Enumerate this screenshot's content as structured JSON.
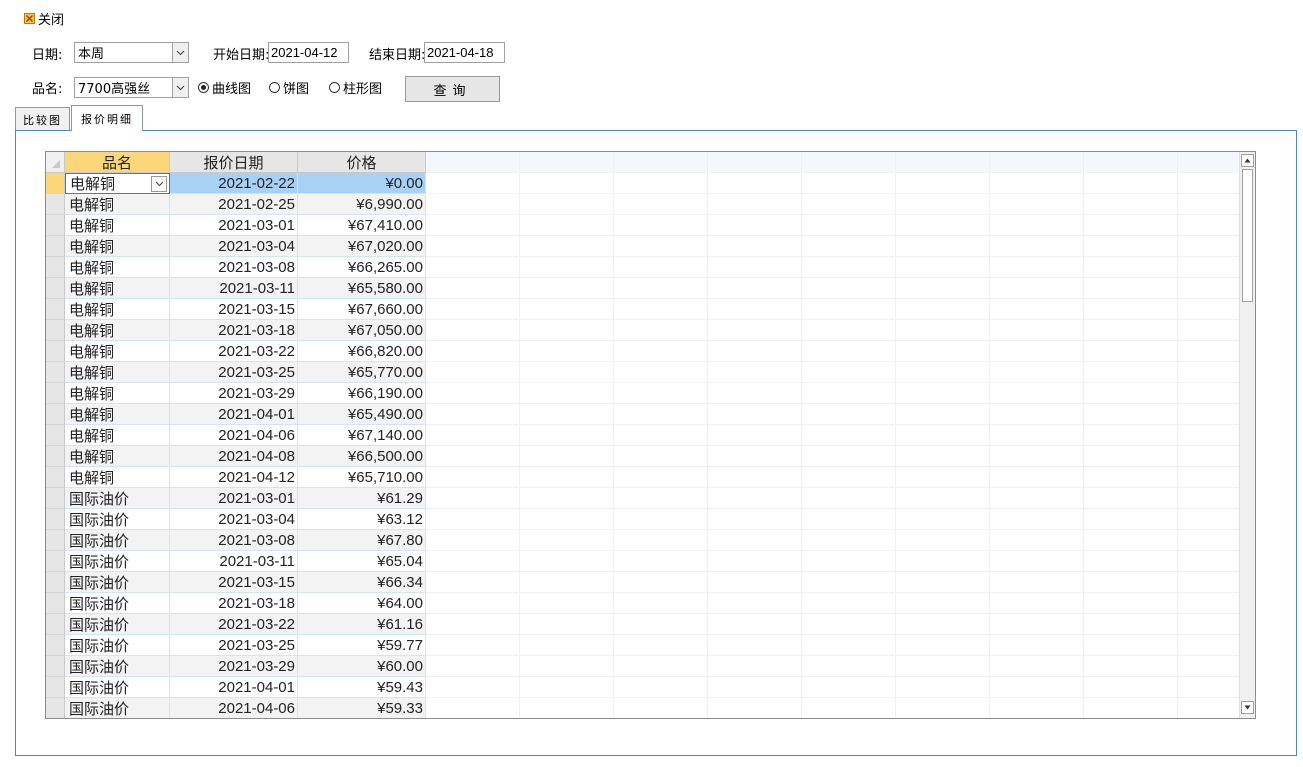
{
  "toolbar": {
    "close_label": "关闭"
  },
  "filters": {
    "date_label": "日期:",
    "date_value": "本周",
    "start_label": "开始日期:",
    "start_value": "2021-04-12",
    "end_label": "结束日期:",
    "end_value": "2021-04-18",
    "product_label": "品名:",
    "product_value": "7700高强丝",
    "chart_options": [
      {
        "label": "曲线图",
        "selected": true
      },
      {
        "label": "饼图",
        "selected": false
      },
      {
        "label": "柱形图",
        "selected": false
      }
    ],
    "query_button": "查询"
  },
  "tabs": [
    {
      "label": "比较图",
      "active": false
    },
    {
      "label": "报价明细",
      "active": true
    }
  ],
  "grid": {
    "columns": [
      "品名",
      "报价日期",
      "价格"
    ],
    "rows": [
      {
        "name": "电解铜",
        "date": "2021-02-22",
        "price": "¥0.00"
      },
      {
        "name": "电解铜",
        "date": "2021-02-25",
        "price": "¥6,990.00"
      },
      {
        "name": "电解铜",
        "date": "2021-03-01",
        "price": "¥67,410.00"
      },
      {
        "name": "电解铜",
        "date": "2021-03-04",
        "price": "¥67,020.00"
      },
      {
        "name": "电解铜",
        "date": "2021-03-08",
        "price": "¥66,265.00"
      },
      {
        "name": "电解铜",
        "date": "2021-03-11",
        "price": "¥65,580.00"
      },
      {
        "name": "电解铜",
        "date": "2021-03-15",
        "price": "¥67,660.00"
      },
      {
        "name": "电解铜",
        "date": "2021-03-18",
        "price": "¥67,050.00"
      },
      {
        "name": "电解铜",
        "date": "2021-03-22",
        "price": "¥66,820.00"
      },
      {
        "name": "电解铜",
        "date": "2021-03-25",
        "price": "¥65,770.00"
      },
      {
        "name": "电解铜",
        "date": "2021-03-29",
        "price": "¥66,190.00"
      },
      {
        "name": "电解铜",
        "date": "2021-04-01",
        "price": "¥65,490.00"
      },
      {
        "name": "电解铜",
        "date": "2021-04-06",
        "price": "¥67,140.00"
      },
      {
        "name": "电解铜",
        "date": "2021-04-08",
        "price": "¥66,500.00"
      },
      {
        "name": "电解铜",
        "date": "2021-04-12",
        "price": "¥65,710.00"
      },
      {
        "name": "国际油价",
        "date": "2021-03-01",
        "price": "¥61.29"
      },
      {
        "name": "国际油价",
        "date": "2021-03-04",
        "price": "¥63.12"
      },
      {
        "name": "国际油价",
        "date": "2021-03-08",
        "price": "¥67.80"
      },
      {
        "name": "国际油价",
        "date": "2021-03-11",
        "price": "¥65.04"
      },
      {
        "name": "国际油价",
        "date": "2021-03-15",
        "price": "¥66.34"
      },
      {
        "name": "国际油价",
        "date": "2021-03-18",
        "price": "¥64.00"
      },
      {
        "name": "国际油价",
        "date": "2021-03-22",
        "price": "¥61.16"
      },
      {
        "name": "国际油价",
        "date": "2021-03-25",
        "price": "¥59.77"
      },
      {
        "name": "国际油价",
        "date": "2021-03-29",
        "price": "¥60.00"
      },
      {
        "name": "国际油价",
        "date": "2021-04-01",
        "price": "¥59.43"
      },
      {
        "name": "国际油价",
        "date": "2021-04-06",
        "price": "¥59.33"
      }
    ]
  },
  "colors": {
    "selection_header": "#fcd77a",
    "current_row": "#a9d0f5",
    "panel_border": "#4a86c8"
  }
}
